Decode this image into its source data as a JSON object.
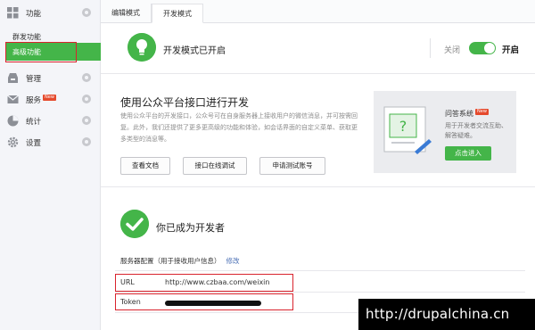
{
  "sidebar": {
    "groups": [
      {
        "label": "功能",
        "icon": "grid-icon"
      },
      {
        "label": "管理",
        "icon": "tray-icon"
      },
      {
        "label": "服务",
        "icon": "mail-icon",
        "badge": "New"
      },
      {
        "label": "统计",
        "icon": "pie-chart-icon"
      },
      {
        "label": "设置",
        "icon": "gear-icon"
      }
    ],
    "sub_items": [
      "群发功能",
      "高级功能"
    ],
    "active_sub_item": "高级功能"
  },
  "tabs": [
    {
      "label": "编辑模式",
      "active": false
    },
    {
      "label": "开发模式",
      "active": true
    }
  ],
  "dev_mode": {
    "status": "开发模式已开启",
    "toggle_off_label": "关闭",
    "toggle_on_label": "开启",
    "enabled": true
  },
  "intro": {
    "title": "使用公众平台接口进行开发",
    "description": "使用公众平台的开发接口，公众号可在自身服务器上接收用户的微信消息，并可按需回复。此外，我们还提供了更多更高级的功能和体验，如会话界面的自定义菜单、获取更多类型的消息等。",
    "buttons": [
      "查看文档",
      "接口在线调试",
      "申请测试账号"
    ]
  },
  "promo": {
    "title": "问答系统",
    "badge": "New",
    "description": "用于开发者交流互助、解答疑难。",
    "button": "点击进入"
  },
  "developer": {
    "title": "你已成为开发者",
    "config_label": "服务器配置（用于接收用户信息）",
    "edit_link": "修改",
    "url_label": "URL",
    "url_value": "http://www.czbaa.com/weixin",
    "token_label": "Token"
  },
  "watermark": "http://drupalchina.cn",
  "colors": {
    "accent": "#44b549",
    "highlight_box": "#d9232d",
    "link": "#4a6fb5"
  }
}
